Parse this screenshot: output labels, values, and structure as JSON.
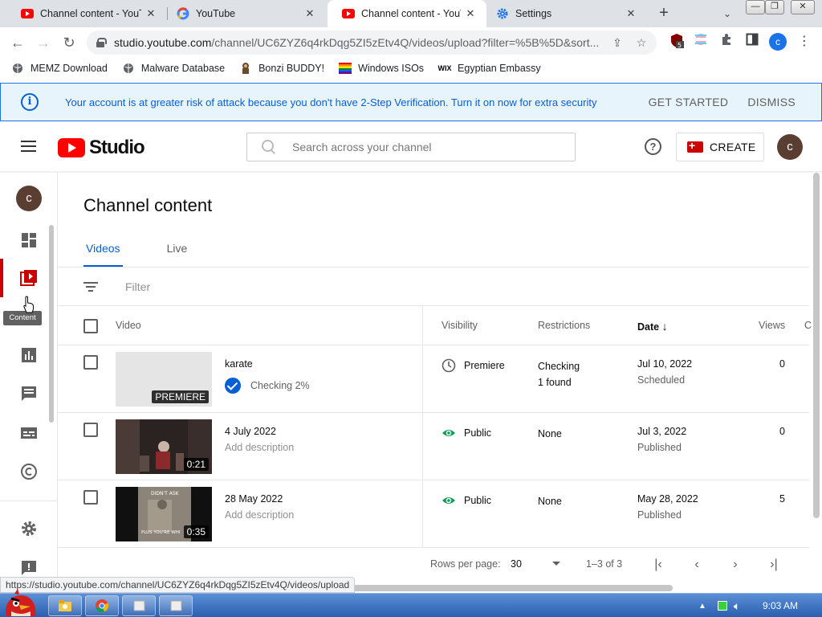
{
  "browser": {
    "tabs": [
      {
        "title": "Channel content - YouTu",
        "favicon": "youtube-icon"
      },
      {
        "title": "YouTube",
        "favicon": "google-icon"
      },
      {
        "title": "Channel content - YouTu",
        "favicon": "youtube-icon"
      },
      {
        "title": "Settings",
        "favicon": "gear-icon"
      }
    ],
    "url_host": "studio.youtube.com",
    "url_path": "/channel/UC6ZYZ6q4rkDqg5ZI5zEtv4Q/videos/upload?filter=%5B%5D&sort...",
    "extension_badge": "5",
    "profile_initial": "c",
    "bookmarks": [
      "MEMZ Download",
      "Malware Database",
      "Bonzi BUDDY!",
      "Windows ISOs",
      "Egyptian Embassy"
    ]
  },
  "banner": {
    "message": "Your account is at greater risk of attack because you don't have 2-Step Verification. Turn it on now for extra security",
    "get_started": "GET STARTED",
    "dismiss": "DISMISS"
  },
  "header": {
    "logo_text": "Studio",
    "search_placeholder": "Search across your channel",
    "create_label": "CREATE",
    "avatar_initial": "c"
  },
  "sidebar": {
    "avatar_initial": "c",
    "tooltip": "Content"
  },
  "content": {
    "title": "Channel content",
    "tabs": [
      "Videos",
      "Live"
    ],
    "filter_placeholder": "Filter",
    "columns": {
      "video": "Video",
      "visibility": "Visibility",
      "restrictions": "Restrictions",
      "date": "Date",
      "views": "Views",
      "comments": "C"
    },
    "rows": [
      {
        "title": "karate",
        "status": "Checking 2%",
        "badge": "PREMIERE",
        "visibility": "Premiere",
        "restrictions_line1": "Checking",
        "restrictions_line2": "1 found",
        "date": "Jul 10, 2022",
        "date_status": "Scheduled",
        "views": "0"
      },
      {
        "title": "4 July 2022",
        "description": "Add description",
        "duration": "0:21",
        "visibility": "Public",
        "restrictions_line1": "None",
        "date": "Jul 3, 2022",
        "date_status": "Published",
        "views": "0"
      },
      {
        "title": "28 May 2022",
        "description": "Add description",
        "duration": "0:35",
        "visibility": "Public",
        "restrictions_line1": "None",
        "date": "May 28, 2022",
        "date_status": "Published",
        "views": "5",
        "thumb_text_top": "DIDN'T ASK",
        "thumb_text_bottom": "PLUS YOU'RE WHI"
      }
    ],
    "pager": {
      "rows_per_page_label": "Rows per page:",
      "rows_per_page": "30",
      "range": "1–3 of 3"
    }
  },
  "status_url": "https://studio.youtube.com/channel/UC6ZYZ6q4rkDqg5ZI5zEtv4Q/videos/upload",
  "taskbar": {
    "clock": "9:03 AM"
  },
  "colors": {
    "brand_red": "#ff0000",
    "accent_blue": "#065fd4",
    "banner_bg": "#e8f4fc",
    "visibility_green": "#0f9d58"
  }
}
